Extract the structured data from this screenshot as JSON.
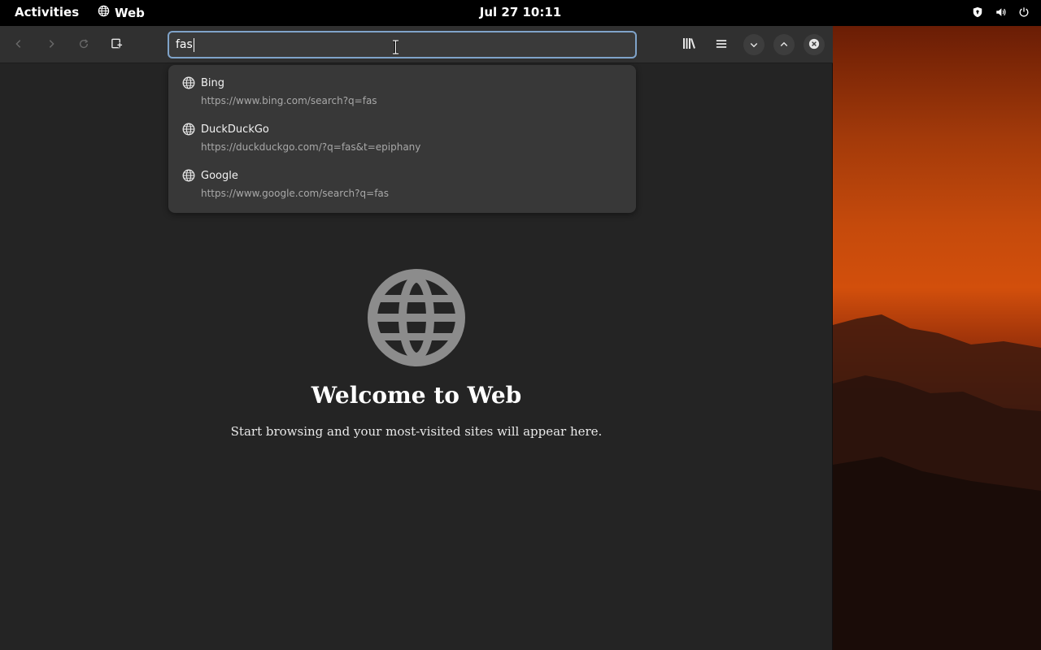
{
  "topbar": {
    "activities": "Activities",
    "app_name": "Web",
    "clock": "Jul 27  10:11",
    "tray_icons": [
      "shield-icon",
      "volume-icon",
      "power-icon"
    ]
  },
  "browser": {
    "nav_icons": [
      "back-icon",
      "forward-icon",
      "reload-icon",
      "new-tab-icon"
    ],
    "address_value": "fas",
    "right_icons": [
      "library-icon",
      "menu-icon",
      "minimize-icon",
      "maximize-icon",
      "close-icon"
    ]
  },
  "suggestions": [
    {
      "name": "Bing",
      "url": "https://www.bing.com/search?q=fas"
    },
    {
      "name": "DuckDuckGo",
      "url": "https://duckduckgo.com/?q=fas&t=epiphany"
    },
    {
      "name": "Google",
      "url": "https://www.google.com/search?q=fas"
    }
  ],
  "welcome": {
    "title": "Welcome to Web",
    "subtitle": "Start browsing and your most-visited sites will appear here."
  },
  "colors": {
    "topbar_bg": "#000000",
    "headerbar_bg": "#303030",
    "content_bg": "#242424",
    "focus_ring": "#7fa3c9",
    "popover_bg": "#383838"
  }
}
